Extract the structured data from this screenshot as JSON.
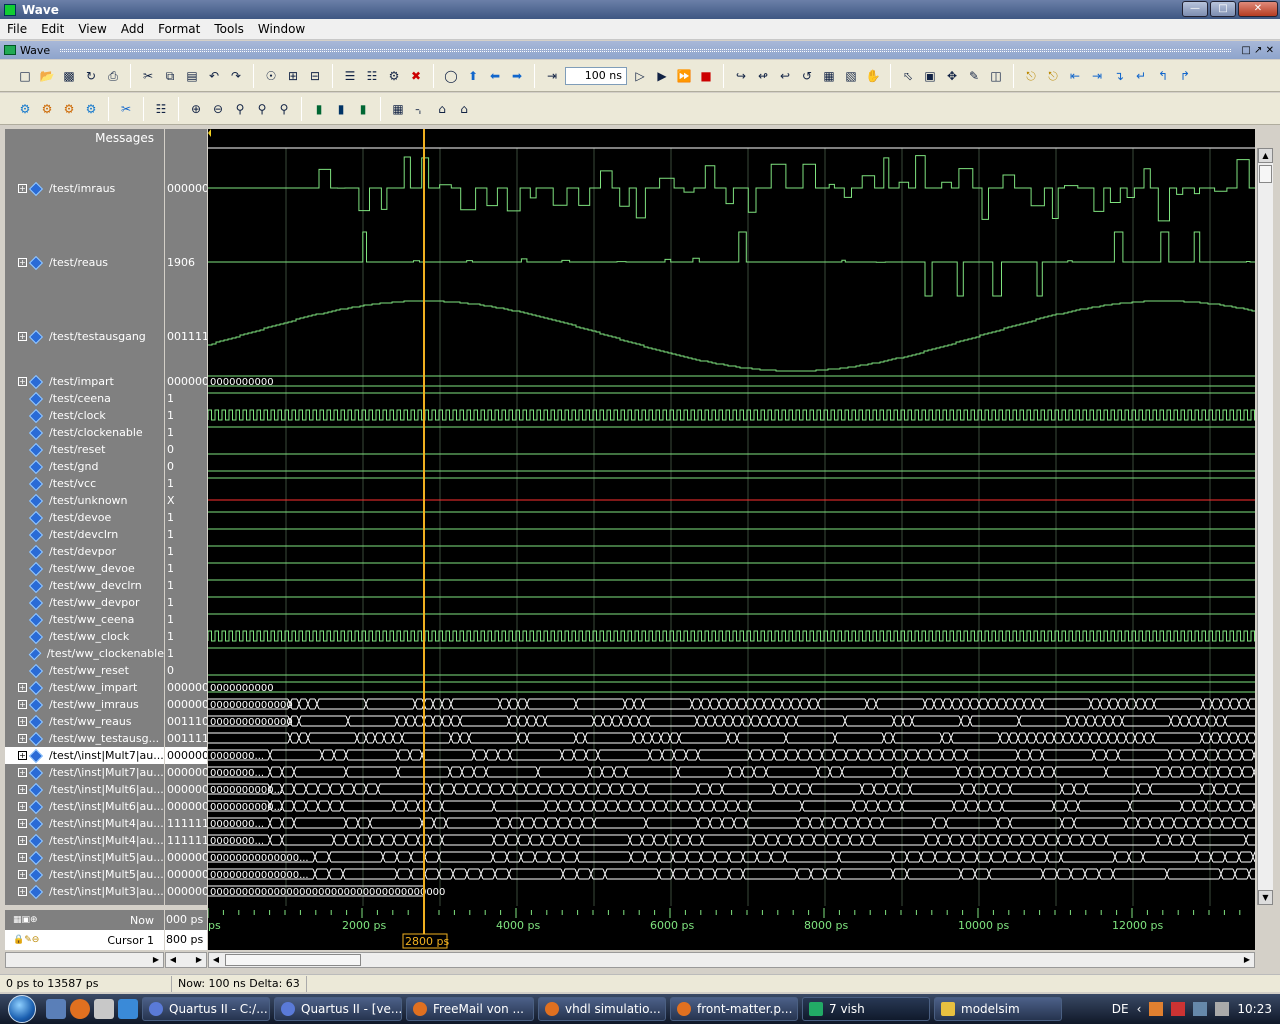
{
  "window": {
    "title": "Wave"
  },
  "menu": [
    "File",
    "Edit",
    "View",
    "Add",
    "Format",
    "Tools",
    "Window"
  ],
  "subwindow": {
    "title": "Wave"
  },
  "toolbar": {
    "zoom_value": "100 ns"
  },
  "headers": {
    "messages": "Messages"
  },
  "signals": [
    {
      "name": "/test/imraus",
      "value": "0000000",
      "expand": true,
      "row": "tall"
    },
    {
      "name": "/test/reaus",
      "value": "1906",
      "expand": true,
      "row": "tall"
    },
    {
      "name": "/test/testausgang",
      "value": "001111",
      "expand": true,
      "row": "tall"
    },
    {
      "name": "/test/impart",
      "value": "0000000",
      "expand": true,
      "wave_label": "0000000000",
      "row": "bus"
    },
    {
      "name": "/test/ceena",
      "value": "1",
      "expand": false,
      "row": "bit"
    },
    {
      "name": "/test/clock",
      "value": "1",
      "expand": false,
      "row": "clock"
    },
    {
      "name": "/test/clockenable",
      "value": "1",
      "expand": false,
      "row": "bit"
    },
    {
      "name": "/test/reset",
      "value": "0",
      "expand": false,
      "row": "bit0"
    },
    {
      "name": "/test/gnd",
      "value": "0",
      "expand": false,
      "row": "bit0"
    },
    {
      "name": "/test/vcc",
      "value": "1",
      "expand": false,
      "row": "bit"
    },
    {
      "name": "/test/unknown",
      "value": "X",
      "expand": false,
      "row": "unknown"
    },
    {
      "name": "/test/devoe",
      "value": "1",
      "expand": false,
      "row": "bit"
    },
    {
      "name": "/test/devclrn",
      "value": "1",
      "expand": false,
      "row": "bit"
    },
    {
      "name": "/test/devpor",
      "value": "1",
      "expand": false,
      "row": "bit"
    },
    {
      "name": "/test/ww_devoe",
      "value": "1",
      "expand": false,
      "row": "bit"
    },
    {
      "name": "/test/ww_devclrn",
      "value": "1",
      "expand": false,
      "row": "bit"
    },
    {
      "name": "/test/ww_devpor",
      "value": "1",
      "expand": false,
      "row": "bit"
    },
    {
      "name": "/test/ww_ceena",
      "value": "1",
      "expand": false,
      "row": "bit"
    },
    {
      "name": "/test/ww_clock",
      "value": "1",
      "expand": false,
      "row": "clock"
    },
    {
      "name": "/test/ww_clockenable",
      "value": "1",
      "expand": false,
      "row": "bit"
    },
    {
      "name": "/test/ww_reset",
      "value": "0",
      "expand": false,
      "row": "bit0"
    },
    {
      "name": "/test/ww_impart",
      "value": "0000000",
      "expand": true,
      "wave_label": "0000000000",
      "row": "bus"
    },
    {
      "name": "/test/ww_imraus",
      "value": "0000000",
      "expand": true,
      "wave_label": "0000000000000",
      "row": "busdense"
    },
    {
      "name": "/test/ww_reaus",
      "value": "001110",
      "expand": true,
      "wave_label": "0000000000000",
      "row": "busdense"
    },
    {
      "name": "/test/ww_testausg...",
      "value": "001111",
      "expand": true,
      "wave_label": "",
      "row": "busdense"
    },
    {
      "name": "/test/\\inst|Mult7|au...",
      "value": "0000000",
      "expand": true,
      "wave_label": "0000000...",
      "row": "busmid",
      "selected": true
    },
    {
      "name": "/test/\\inst|Mult7|au...",
      "value": "0000000",
      "expand": true,
      "wave_label": "0000000...",
      "row": "busmid"
    },
    {
      "name": "/test/\\inst|Mult6|au...",
      "value": "0000000",
      "expand": true,
      "wave_label": "0000000000...",
      "row": "busmid"
    },
    {
      "name": "/test/\\inst|Mult6|au...",
      "value": "0000000",
      "expand": true,
      "wave_label": "0000000000...",
      "row": "busmid"
    },
    {
      "name": "/test/\\inst|Mult4|au...",
      "value": "111111",
      "expand": true,
      "wave_label": "0000000...",
      "row": "busmid"
    },
    {
      "name": "/test/\\inst|Mult4|au...",
      "value": "111111",
      "expand": true,
      "wave_label": "0000000...",
      "row": "busmid"
    },
    {
      "name": "/test/\\inst|Mult5|au...",
      "value": "0000000",
      "expand": true,
      "wave_label": "00000000000000...",
      "row": "buswide"
    },
    {
      "name": "/test/\\inst|Mult5|au...",
      "value": "0000000",
      "expand": true,
      "wave_label": "00000000000000...",
      "row": "buswide"
    },
    {
      "name": "/test/\\inst|Mult3|au...",
      "value": "0000000",
      "expand": true,
      "wave_label": "0000000000000000000000000000000000000",
      "row": "buslong"
    }
  ],
  "cursor": {
    "time_label": "2800 ps"
  },
  "timeline": {
    "ticks": [
      "ps",
      "2000 ps",
      "4000 ps",
      "6000 ps",
      "8000 ps",
      "10000 ps",
      "12000 ps"
    ]
  },
  "bottom": {
    "now_label": "Now",
    "now_value": "000 ps",
    "cursor_label": "Cursor 1",
    "cursor_value": "800 ps"
  },
  "status": {
    "range": "0 ps to 13587 ps",
    "now": "Now: 100 ns  Delta: 63"
  },
  "taskbar": {
    "items": [
      "Quartus II - C:/...",
      "Quartus II - [ve...",
      "FreeMail von ...",
      "vhdl simulatio...",
      "front-matter.p...",
      "7 vish",
      "modelsim"
    ],
    "lang": "DE",
    "clock": "10:23"
  },
  "colors": {
    "wave": "#7fe37f",
    "unknown": "#ff3030",
    "cursor": "#f0b020",
    "grid": "#3a4a3a"
  }
}
